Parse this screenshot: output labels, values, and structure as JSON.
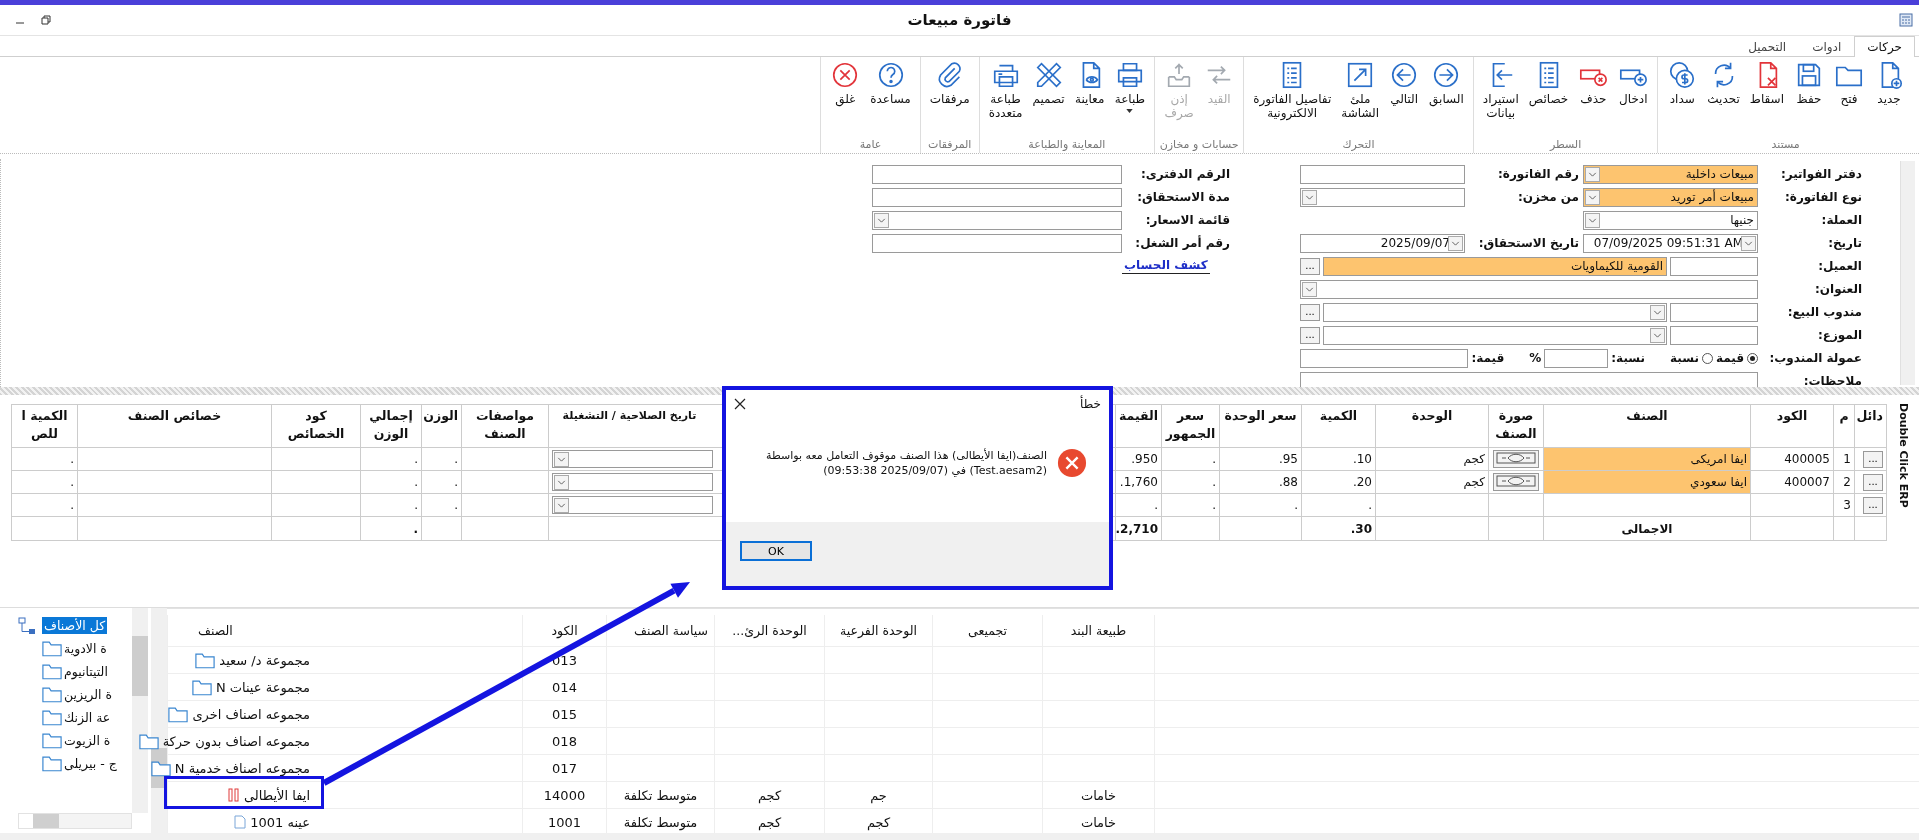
{
  "window": {
    "title": "فاتورة مبيعات"
  },
  "tabs": [
    {
      "label": "حركات",
      "selected": true
    },
    {
      "label": "ادوات",
      "selected": false
    },
    {
      "label": "التحميل",
      "selected": false
    }
  ],
  "ribbon": {
    "groups": [
      {
        "label": "مستند",
        "buttons": [
          {
            "label": "جديد",
            "disabled": false,
            "dropdown": false
          },
          {
            "label": "فتح",
            "disabled": false,
            "dropdown": false
          },
          {
            "label": "حفظ",
            "disabled": false,
            "dropdown": false
          },
          {
            "label": "اسقاط",
            "disabled": false,
            "dropdown": false
          },
          {
            "label": "تحديث",
            "disabled": false,
            "dropdown": false
          },
          {
            "label": "سداد",
            "disabled": false,
            "dropdown": false
          }
        ]
      },
      {
        "label": "السطر",
        "buttons": [
          {
            "label": "ادخال",
            "disabled": false,
            "dropdown": false
          },
          {
            "label": "حذف",
            "disabled": false,
            "dropdown": false
          },
          {
            "label": "خصائص",
            "disabled": false,
            "dropdown": false
          },
          {
            "label": "استيراد\nبيانات",
            "disabled": false,
            "dropdown": false
          }
        ]
      },
      {
        "label": "التحرك",
        "buttons": [
          {
            "label": "السابق",
            "disabled": false,
            "dropdown": false
          },
          {
            "label": "التالي",
            "disabled": false,
            "dropdown": false
          },
          {
            "label": "ملئ\nالشاشة",
            "disabled": false,
            "dropdown": false
          },
          {
            "label": "تفاصيل الفاتورة\nالالكترونية",
            "disabled": false,
            "dropdown": false
          }
        ]
      },
      {
        "label": "حسابات و مخازن",
        "buttons": [
          {
            "label": "القيد",
            "disabled": true,
            "dropdown": false
          },
          {
            "label": "إذن\nصرف",
            "disabled": true,
            "dropdown": false
          }
        ]
      },
      {
        "label": "المعاينة والطباعة",
        "buttons": [
          {
            "label": "طباعة",
            "disabled": false,
            "dropdown": true
          },
          {
            "label": "معاينة",
            "disabled": false,
            "dropdown": false
          },
          {
            "label": "تصميم",
            "disabled": false,
            "dropdown": false
          },
          {
            "label": "طباعة\nمتعددة",
            "disabled": false,
            "dropdown": false
          }
        ]
      },
      {
        "label": "المرفقات",
        "buttons": [
          {
            "label": "مرفقات",
            "disabled": false,
            "dropdown": false
          }
        ]
      },
      {
        "label": "عامة",
        "buttons": [
          {
            "label": "مساعدة",
            "disabled": false,
            "dropdown": false
          },
          {
            "label": "غلق",
            "disabled": false,
            "dropdown": false
          }
        ]
      }
    ]
  },
  "form": {
    "main": [
      {
        "label": "دفتر الفواتير:",
        "kind": "combo",
        "value": "مبيعات داخلية",
        "highlighted": true
      },
      {
        "label": "نوع الفاتورة:",
        "kind": "combo",
        "value": "مبيعات أمر توريد",
        "highlighted": true
      },
      {
        "label": "العملة:",
        "kind": "combo",
        "value": "جنيها",
        "highlighted": false
      },
      {
        "label": "تاريخ:",
        "kind": "date",
        "value": "07/09/2025 09:51:31 AM",
        "highlighted": false
      },
      {
        "label": "العميل:",
        "kind": "lookup",
        "value": "القومية للكيماويات",
        "button": "...",
        "highlighted": true
      },
      {
        "label": "العنوان:",
        "kind": "combo",
        "highlighted": false
      },
      {
        "label": "مندوب البيع:",
        "kind": "lookup-combo",
        "button": "...",
        "highlighted": false
      },
      {
        "label": "الموزع:",
        "kind": "lookup-combo",
        "button": "...",
        "highlighted": false
      },
      {
        "label": "عمولة المندوب:",
        "kind": "commission",
        "options": [
          {
            "label": "قيمة",
            "selected": true
          },
          {
            "label": "نسبة",
            "selected": false
          }
        ],
        "percent_label": "نسبة:",
        "percent_sign": "%",
        "value_label": "قيمة:",
        "highlighted": false
      },
      {
        "label": "ملاحظات:",
        "kind": "notes",
        "highlighted": false
      }
    ],
    "middle": [
      {
        "label": "رقم الفاتورة:",
        "kind": "text"
      },
      {
        "label": "من مخزن:",
        "kind": "combo"
      },
      {
        "label": "تاريخ الاستحقاق:",
        "kind": "date",
        "value": "2025/09/07"
      }
    ],
    "side": [
      {
        "label": "الرقم الدفترى:",
        "kind": "text"
      },
      {
        "label": "مدة الاستحقاق:",
        "kind": "text"
      },
      {
        "label": "قائمة الاسعار:",
        "kind": "combo"
      },
      {
        "label": "رقم أمر الشغل:",
        "kind": "text"
      }
    ],
    "account_link": "كشف الحساب"
  },
  "grid": {
    "columns": [
      {
        "label": "دائل",
        "kind": "button"
      },
      {
        "label": "م",
        "kind": "index"
      },
      {
        "label": "الكود",
        "kind": "text"
      },
      {
        "label": "الصنف",
        "kind": "item"
      },
      {
        "label": "صورة الصنف",
        "kind": "photo"
      },
      {
        "label": "الوحدة",
        "kind": "text"
      },
      {
        "label": "الكمية",
        "kind": "number"
      },
      {
        "label": "سعر الوحدة",
        "kind": "number"
      },
      {
        "label": "سعر الجمهور",
        "kind": "number"
      },
      {
        "label": "القيمة",
        "kind": "number"
      },
      {
        "label": "تاريخ الصلاحية / التشغيلة",
        "kind": "date"
      },
      {
        "label": "مواصفات الصنف",
        "kind": "text"
      },
      {
        "label": "الوزن",
        "kind": "number"
      },
      {
        "label": "إجمالي الوزن",
        "kind": "number"
      },
      {
        "label": "كود الخصائص",
        "kind": "text"
      },
      {
        "label": "خصائص الصنف",
        "kind": "text"
      },
      {
        "label": "الكمية ا للص",
        "kind": "number"
      }
    ],
    "rows": [
      {
        "cells": [
          "...",
          "1",
          "400005",
          "ايفا امريكى",
          null,
          "كجم",
          "10.",
          "95.",
          ".",
          "950.",
          null,
          null,
          ".",
          ".",
          null,
          null,
          "."
        ],
        "highlighted": true,
        "has_photo": true
      },
      {
        "cells": [
          "...",
          "2",
          "400007",
          "ايفا سعودي",
          null,
          "كجم",
          "20.",
          "88.",
          ".",
          "1,760.",
          null,
          null,
          ".",
          ".",
          null,
          null,
          "."
        ],
        "highlighted": true,
        "has_photo": true
      },
      {
        "cells": [
          "...",
          "3",
          null,
          null,
          null,
          null,
          ".",
          ".",
          ".",
          ".",
          null,
          null,
          ".",
          ".",
          null,
          null,
          "."
        ],
        "highlighted": false,
        "has_photo": false
      }
    ],
    "total": {
      "cells": [
        null,
        null,
        null,
        "الاجمالى",
        null,
        null,
        "30.",
        null,
        null,
        "2,710.",
        null,
        null,
        null,
        ".",
        null,
        null,
        null
      ]
    }
  },
  "side_label": "Double Click ERP",
  "dialog": {
    "title": "خطأ",
    "message": "الصنف(ايفا الأيطالى) هذا الصنف موقوف التعامل معه بواسطة (Test.aesam2) في (2025/09/07 09:53:38)",
    "button": "OK"
  },
  "tree": {
    "label": "كل الأصناف",
    "selected": true,
    "children": [
      {
        "label": "ة الادوية",
        "selected": false
      },
      {
        "label": "التيتانيوم",
        "selected": false
      },
      {
        "label": "ة الريزين",
        "selected": false
      },
      {
        "label": "عة الزنك",
        "selected": false
      },
      {
        "label": "ة الزيوت",
        "selected": false
      },
      {
        "label": "ج - بيريلى",
        "selected": false
      }
    ]
  },
  "item_list": {
    "columns": [
      "طبيعة البند",
      "تجميعى",
      "الوحدة الفرعية",
      "الوحدة الرئ...",
      "سياسة الصنف",
      "الكود",
      "الصنف"
    ],
    "rows": [
      {
        "kind": "group",
        "cells": [
          null,
          null,
          null,
          null,
          null,
          "013",
          "مجموعة د/ سعيد"
        ]
      },
      {
        "kind": "group",
        "cells": [
          null,
          null,
          null,
          null,
          null,
          "014",
          "مجموعة عينات N"
        ]
      },
      {
        "kind": "group",
        "cells": [
          null,
          null,
          null,
          null,
          null,
          "015",
          "مجموعه اصناف اخرى"
        ]
      },
      {
        "kind": "group",
        "cells": [
          null,
          null,
          null,
          null,
          null,
          "018",
          "مجموعه اصناف بدون حركة"
        ]
      },
      {
        "kind": "group",
        "cells": [
          null,
          null,
          null,
          null,
          null,
          "017",
          "مجموعه اصناف خدمية N"
        ]
      },
      {
        "kind": "stopped",
        "cells": [
          "خامات",
          null,
          "جم",
          "كجم",
          "متوسط تكلفة",
          "14000",
          "ايفا الأيطالى"
        ]
      },
      {
        "kind": "item",
        "cells": [
          "خامات",
          null,
          "كجم",
          "كجم",
          "متوسط تكلفة",
          "1001",
          "عينه 1001"
        ]
      }
    ]
  }
}
